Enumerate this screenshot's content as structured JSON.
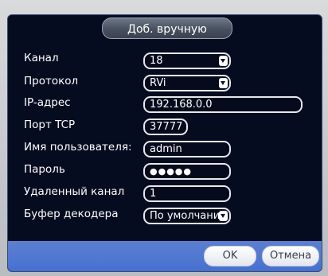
{
  "dialog": {
    "title": "Доб. вручную"
  },
  "form": {
    "channel": {
      "label": "Канал",
      "value": "18"
    },
    "protocol": {
      "label": "Протокол",
      "value": "RVi"
    },
    "ip_address": {
      "label": "IP-адрес",
      "value": "192.168.0.0"
    },
    "tcp_port": {
      "label": "Порт TCP",
      "value": "37777"
    },
    "username": {
      "label": "Имя пользователя:",
      "value": "admin"
    },
    "password": {
      "label": "Пароль",
      "value": "●●●●●"
    },
    "remote_channel": {
      "label": "Удаленный канал",
      "value": "1"
    },
    "decoder_buffer": {
      "label": "Буфер декодера",
      "value": "По умолчани"
    }
  },
  "buttons": {
    "ok": "OK",
    "cancel": "Отмена"
  },
  "colors": {
    "dialog_background": "#060c20",
    "footer_bar": "#4f78d2",
    "field_border": "#e6e8ee",
    "text": "#ffffff"
  },
  "icons": {
    "dropdown": "chevron-down-icon"
  }
}
